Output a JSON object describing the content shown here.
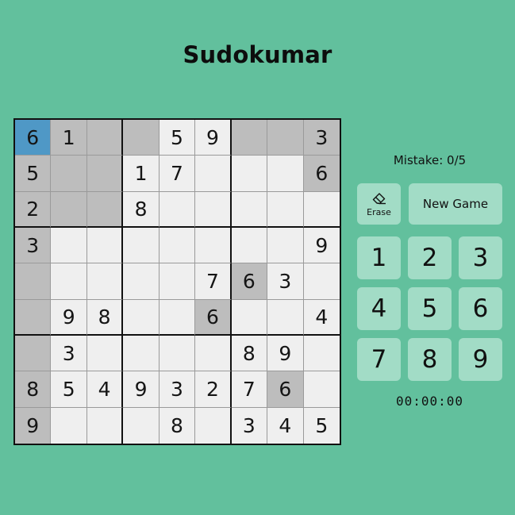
{
  "title": "Sudokumar",
  "board": {
    "cells": [
      [
        "6",
        "1",
        "",
        "",
        "5",
        "9",
        "",
        "",
        "3"
      ],
      [
        "5",
        "",
        "",
        "1",
        "7",
        "",
        "",
        "",
        "6"
      ],
      [
        "2",
        "",
        "",
        "8",
        "",
        "",
        "",
        "",
        ""
      ],
      [
        "3",
        "",
        "",
        "",
        "",
        "",
        "",
        "",
        "9"
      ],
      [
        "",
        "",
        "",
        "",
        "",
        "7",
        "6",
        "3",
        ""
      ],
      [
        "",
        "9",
        "8",
        "",
        "",
        "6",
        "",
        "",
        "4"
      ],
      [
        "",
        "3",
        "",
        "",
        "",
        "",
        "8",
        "9",
        ""
      ],
      [
        "8",
        "5",
        "4",
        "9",
        "3",
        "2",
        "7",
        "6",
        ""
      ],
      [
        "9",
        "",
        "",
        "",
        "8",
        "",
        "3",
        "4",
        "5"
      ]
    ],
    "selected": [
      0,
      0
    ],
    "highlighted": [
      [
        0,
        1
      ],
      [
        0,
        2
      ],
      [
        0,
        3
      ],
      [
        0,
        6
      ],
      [
        0,
        7
      ],
      [
        0,
        8
      ],
      [
        1,
        0
      ],
      [
        1,
        1
      ],
      [
        1,
        2
      ],
      [
        1,
        8
      ],
      [
        2,
        0
      ],
      [
        2,
        1
      ],
      [
        2,
        2
      ],
      [
        3,
        0
      ],
      [
        4,
        0
      ],
      [
        5,
        0
      ],
      [
        6,
        0
      ],
      [
        7,
        0
      ],
      [
        8,
        0
      ],
      [
        4,
        6
      ],
      [
        5,
        5
      ],
      [
        7,
        7
      ]
    ],
    "colors": {
      "selected": "#4f98c6",
      "highlighted": "#bdbdbd",
      "cell": "#efefef"
    }
  },
  "sidebar": {
    "mistake_text": "Mistake: 0/5",
    "erase_label": "Erase",
    "erase_icon": "eraser-icon",
    "new_game_label": "New Game",
    "numbers": [
      "1",
      "2",
      "3",
      "4",
      "5",
      "6",
      "7",
      "8",
      "9"
    ],
    "timer": "00:00:00"
  },
  "colors": {
    "background": "#62c09d",
    "button": "#a2dcc6"
  }
}
